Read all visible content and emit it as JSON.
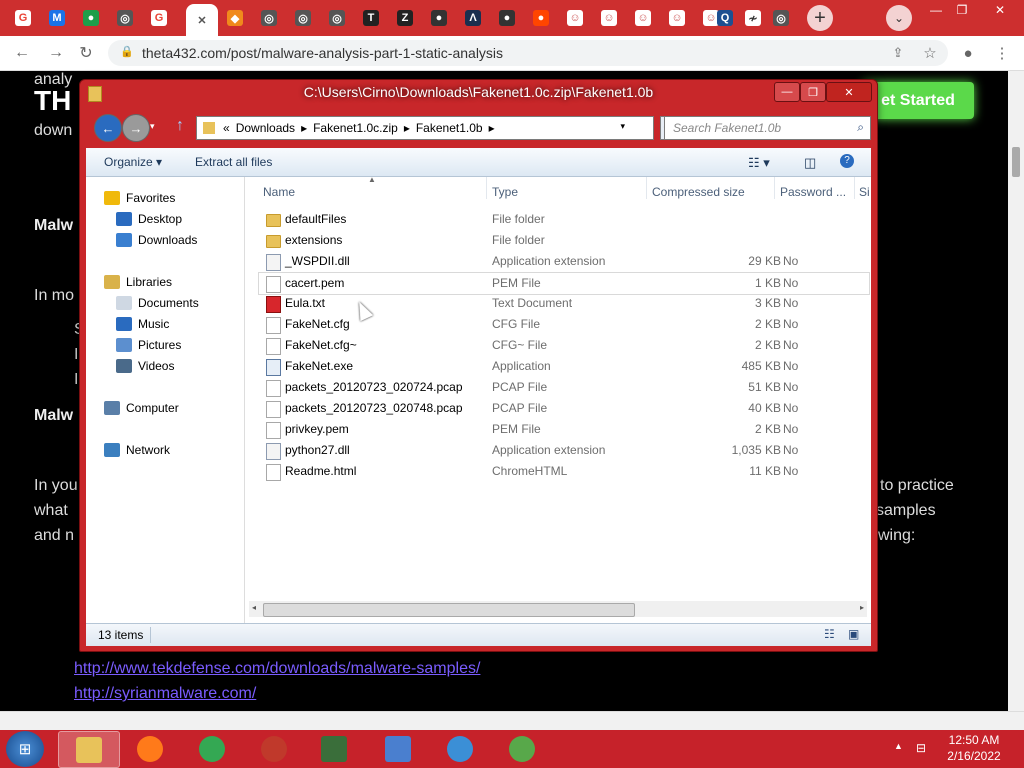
{
  "browser": {
    "tab_favicons": [
      {
        "name": "google-icon",
        "letter": "G",
        "color": "#ea4335",
        "bg": "#fff"
      },
      {
        "name": "malwarebytes-icon",
        "letter": "M",
        "color": "#fff",
        "bg": "#1a73e8"
      },
      {
        "name": "green-app-icon",
        "letter": "●",
        "color": "#fff",
        "bg": "#1e9e4a"
      },
      {
        "name": "tor-icon",
        "letter": "◎",
        "color": "#fff",
        "bg": "#555"
      },
      {
        "name": "google-icon",
        "letter": "G",
        "color": "#ea4335",
        "bg": "#fff"
      },
      {
        "name": "close-icon",
        "letter": "✕",
        "color": "#555",
        "bg": "transparent"
      },
      {
        "name": "orange-diamond-icon",
        "letter": "◆",
        "color": "#fff",
        "bg": "#f08a1c"
      },
      {
        "name": "tor-icon",
        "letter": "◎",
        "color": "#fff",
        "bg": "#555"
      },
      {
        "name": "tor-icon",
        "letter": "◎",
        "color": "#fff",
        "bg": "#555"
      },
      {
        "name": "tor-icon",
        "letter": "◎",
        "color": "#fff",
        "bg": "#555"
      },
      {
        "name": "tpot-icon",
        "letter": "T",
        "color": "#fff",
        "bg": "#222"
      },
      {
        "name": "zotero-icon",
        "letter": "Z",
        "color": "#fff",
        "bg": "#222"
      },
      {
        "name": "github-icon",
        "letter": "●",
        "color": "#fff",
        "bg": "#333"
      },
      {
        "name": "lambda-icon",
        "letter": "Λ",
        "color": "#fff",
        "bg": "#1a2f4f"
      },
      {
        "name": "github-icon",
        "letter": "●",
        "color": "#fff",
        "bg": "#333"
      },
      {
        "name": "reddit-icon",
        "letter": "●",
        "color": "#fff",
        "bg": "#ff4500"
      },
      {
        "name": "avatar-icon",
        "letter": "☺",
        "color": "#c55",
        "bg": "#fff"
      },
      {
        "name": "avatar-icon",
        "letter": "☺",
        "color": "#c55",
        "bg": "#fff"
      },
      {
        "name": "avatar-icon",
        "letter": "☺",
        "color": "#c55",
        "bg": "#fff"
      },
      {
        "name": "avatar-icon",
        "letter": "☺",
        "color": "#c55",
        "bg": "#fff"
      },
      {
        "name": "avatar-icon",
        "letter": "☺",
        "color": "#c55",
        "bg": "#fff"
      },
      {
        "name": "qualys-icon",
        "letter": "Q",
        "color": "#fff",
        "bg": "#1d4f91"
      },
      {
        "name": "wiki-icon",
        "letter": "≁",
        "color": "#333",
        "bg": "#fff"
      },
      {
        "name": "tor-icon",
        "letter": "◎",
        "color": "#fff",
        "bg": "#555"
      }
    ],
    "new_tab": "+",
    "tab_search": "⌄",
    "window_controls": [
      "—",
      "❐",
      "✕"
    ],
    "url": "theta432.com/post/malware-analysis-part-1-static-analysis"
  },
  "webpage": {
    "logo": "TH",
    "get_started": "et Started",
    "text_fragments": [
      {
        "t": "analy",
        "b": false
      },
      {
        "t": "down",
        "b": false
      },
      {
        "t": "Malw",
        "b": true
      },
      {
        "t": "In mo",
        "b": false
      },
      {
        "t": "S",
        "b": false
      },
      {
        "t": "I",
        "b": false
      },
      {
        "t": "I",
        "b": false
      },
      {
        "t": "Malw",
        "b": true
      },
      {
        "t": "In you",
        "b": false
      },
      {
        "t": "what",
        "b": false
      },
      {
        "t": "and n",
        "b": false
      },
      {
        "t": "to practice",
        "b": false
      },
      {
        "t": "samples",
        "b": false
      },
      {
        "t": "wing:",
        "b": false
      }
    ],
    "links": [
      "http://www.tekdefense.com/downloads/malware-samples/",
      "http://syrianmalware.com/"
    ]
  },
  "explorer": {
    "title": "C:\\Users\\Cirno\\Downloads\\Fakenet1.0c.zip\\Fakenet1.0b",
    "breadcrumb": [
      "«",
      "Downloads",
      "▸",
      "Fakenet1.0c.zip",
      "▸",
      "Fakenet1.0b",
      "▸"
    ],
    "search_placeholder": "Search Fakenet1.0b",
    "commands": {
      "organize": "Organize ▾",
      "extract": "Extract all files"
    },
    "nav_pane": [
      {
        "label": "Favorites",
        "icon": "star-icon",
        "color": "#f0b90b"
      },
      {
        "label": "Desktop",
        "icon": "desktop-icon",
        "color": "#2a6bbf"
      },
      {
        "label": "Downloads",
        "icon": "downloads-icon",
        "color": "#3a7fd0"
      },
      {
        "label": "Libraries",
        "icon": "libraries-icon",
        "color": "#d9b24a"
      },
      {
        "label": "Documents",
        "icon": "documents-icon",
        "color": "#cfd8e3"
      },
      {
        "label": "Music",
        "icon": "music-icon",
        "color": "#2a6bbf"
      },
      {
        "label": "Pictures",
        "icon": "pictures-icon",
        "color": "#5c8fcf"
      },
      {
        "label": "Videos",
        "icon": "videos-icon",
        "color": "#4a6a8a"
      },
      {
        "label": "Computer",
        "icon": "computer-icon",
        "color": "#5a7fa8"
      },
      {
        "label": "Network",
        "icon": "network-icon",
        "color": "#3b7fbf"
      }
    ],
    "columns": [
      "Name",
      "Type",
      "Compressed size",
      "Password ...",
      "Si"
    ],
    "files": [
      {
        "name": "defaultFiles",
        "type": "File folder",
        "size": "",
        "password": "",
        "icon": "folder-icon",
        "kind": "fold"
      },
      {
        "name": "extensions",
        "type": "File folder",
        "size": "",
        "password": "",
        "icon": "folder-icon",
        "kind": "fold"
      },
      {
        "name": "_WSPDII.dll",
        "type": "Application extension",
        "size": "29 KB",
        "password": "No",
        "icon": "dll-icon",
        "kind": "dll"
      },
      {
        "name": "cacert.pem",
        "type": "PEM File",
        "size": "1 KB",
        "password": "No",
        "icon": "file-icon",
        "kind": "doc"
      },
      {
        "name": "Eula.txt",
        "type": "Text Document",
        "size": "3 KB",
        "password": "No",
        "icon": "text-file-icon",
        "kind": "txt"
      },
      {
        "name": "FakeNet.cfg",
        "type": "CFG File",
        "size": "2 KB",
        "password": "No",
        "icon": "file-icon",
        "kind": "doc"
      },
      {
        "name": "FakeNet.cfg~",
        "type": "CFG~ File",
        "size": "2 KB",
        "password": "No",
        "icon": "file-icon",
        "kind": "doc"
      },
      {
        "name": "FakeNet.exe",
        "type": "Application",
        "size": "485 KB",
        "password": "No",
        "icon": "exe-icon",
        "kind": "exe"
      },
      {
        "name": "packets_20120723_020724.pcap",
        "type": "PCAP File",
        "size": "51 KB",
        "password": "No",
        "icon": "file-icon",
        "kind": "doc"
      },
      {
        "name": "packets_20120723_020748.pcap",
        "type": "PCAP File",
        "size": "40 KB",
        "password": "No",
        "icon": "file-icon",
        "kind": "doc"
      },
      {
        "name": "privkey.pem",
        "type": "PEM File",
        "size": "2 KB",
        "password": "No",
        "icon": "file-icon",
        "kind": "doc"
      },
      {
        "name": "python27.dll",
        "type": "Application extension",
        "size": "1,035 KB",
        "password": "No",
        "icon": "dll-icon",
        "kind": "dll"
      },
      {
        "name": "Readme.html",
        "type": "ChromeHTML",
        "size": "11 KB",
        "password": "No",
        "icon": "file-icon",
        "kind": "doc"
      }
    ],
    "status": "13 items"
  },
  "taskbar": {
    "start": "⊞",
    "apps": [
      {
        "name": "explorer-taskbar-icon",
        "color": "#e8c25a"
      },
      {
        "name": "firefox-taskbar-icon",
        "color": "#ff7a1a"
      },
      {
        "name": "chrome-taskbar-icon",
        "color": "#34a853"
      },
      {
        "name": "app-red-taskbar-icon",
        "color": "#c0392b"
      },
      {
        "name": "notes-taskbar-icon",
        "color": "#3a6e3a"
      },
      {
        "name": "wordpad-taskbar-icon",
        "color": "#4a7fcf"
      },
      {
        "name": "control-panel-taskbar-icon",
        "color": "#3b8fd6"
      },
      {
        "name": "network-taskbar-icon",
        "color": "#58a84a"
      }
    ],
    "tray_up": "▲",
    "tray_net": "⊟",
    "time": "12:50 AM",
    "date": "2/16/2022"
  },
  "colors": {
    "window_frame": "#c8272a",
    "taskbar": "#c6222a",
    "page_bg": "#000000",
    "accent_green": "#5bd94a"
  }
}
